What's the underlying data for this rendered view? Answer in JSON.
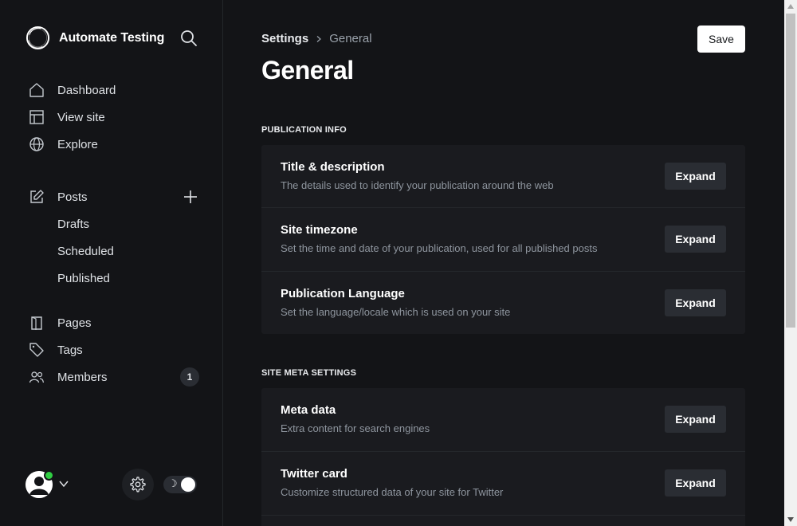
{
  "sidebar": {
    "brand_name": "Automate Testing",
    "nav_primary": [
      {
        "label": "Dashboard",
        "icon": "house-icon"
      },
      {
        "label": "View site",
        "icon": "layout-icon"
      },
      {
        "label": "Explore",
        "icon": "globe-icon"
      }
    ],
    "posts": {
      "label": "Posts",
      "icon": "pencil-square-icon"
    },
    "posts_sub": [
      {
        "label": "Drafts"
      },
      {
        "label": "Scheduled"
      },
      {
        "label": "Published"
      }
    ],
    "nav_secondary": [
      {
        "label": "Pages",
        "icon": "page-icon"
      },
      {
        "label": "Tags",
        "icon": "tag-icon"
      },
      {
        "label": "Members",
        "icon": "members-icon",
        "badge": "1"
      }
    ],
    "theme_toggle_icon": "☽"
  },
  "header": {
    "breadcrumb_parent": "Settings",
    "breadcrumb_current": "General",
    "title": "General",
    "save_label": "Save"
  },
  "sections": [
    {
      "title": "PUBLICATION INFO",
      "rows": [
        {
          "title": "Title & description",
          "description": "The details used to identify your publication around the web",
          "action": "Expand"
        },
        {
          "title": "Site timezone",
          "description": "Set the time and date of your publication, used for all published posts",
          "action": "Expand"
        },
        {
          "title": "Publication Language",
          "description": "Set the language/locale which is used on your site",
          "action": "Expand"
        }
      ]
    },
    {
      "title": "SITE META SETTINGS",
      "rows": [
        {
          "title": "Meta data",
          "description": "Extra content for search engines",
          "action": "Expand"
        },
        {
          "title": "Twitter card",
          "description": "Customize structured data of your site for Twitter",
          "action": "Expand"
        }
      ]
    }
  ],
  "colors": {
    "background": "#131417",
    "card": "#1a1b1f",
    "button_dark": "#2a2d33",
    "online": "#30cf43",
    "text_muted": "#8e959e"
  }
}
